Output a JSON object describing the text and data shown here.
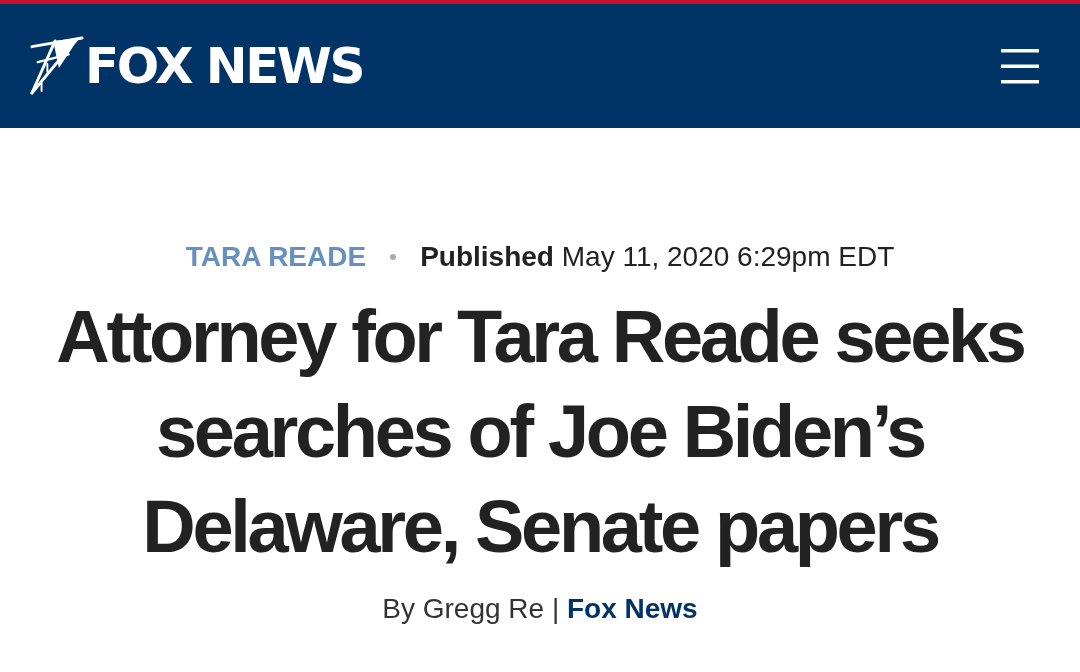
{
  "header": {
    "logo": "FOX NEWS"
  },
  "article": {
    "category": "TARA READE",
    "published": "**Published** May 11, 2020 6:29pm EDT",
    "headline": "Attorney for Tara Reade seeks searches of Joe Biden’s Delaware, Senate papers",
    "byline": {
      "author": "By Gregg Re |",
      "source": "Fox News"
    }
  }
}
